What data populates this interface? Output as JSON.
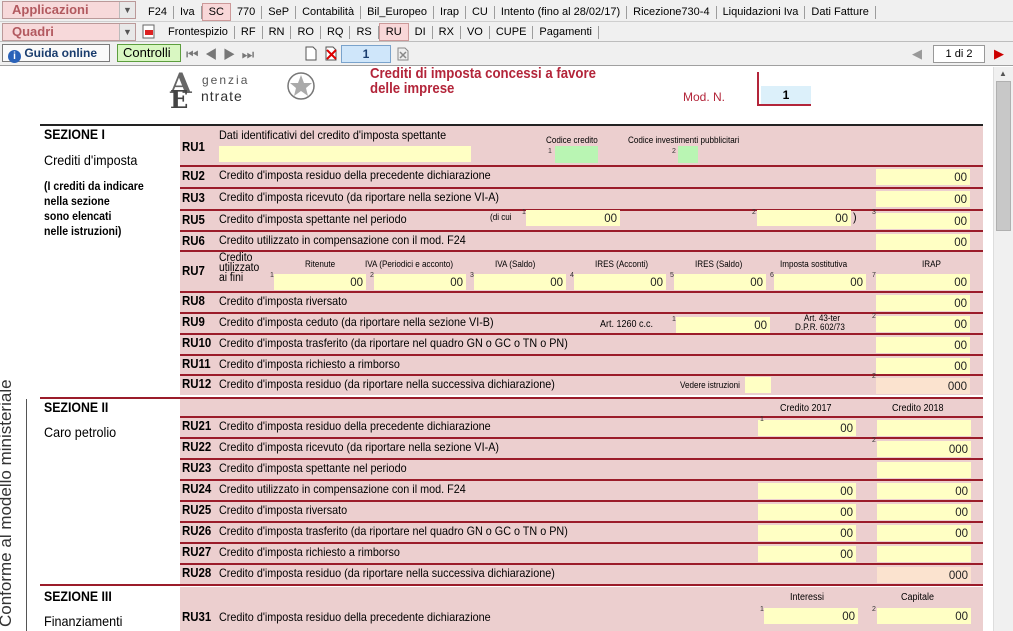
{
  "toolbar": {
    "applicazioni": "Applicazioni",
    "quadri": "Quadri",
    "tabs_top": [
      "F24",
      "Iva",
      "SC",
      "770",
      "SeP",
      "Contabilità",
      "Bil_Europeo",
      "Irap",
      "CU",
      "Intento (fino al 28/02/17)",
      "Ricezione730-4",
      "Liquidazioni Iva",
      "Dati Fatture"
    ],
    "selected_top": "SC",
    "tabs_quadri": [
      "Frontespizio",
      "RF",
      "RN",
      "RO",
      "RQ",
      "RS",
      "RU",
      "DI",
      "RX",
      "VO",
      "CUPE",
      "Pagamenti"
    ],
    "selected_quadro": "RU",
    "guida": "Guida online",
    "controlli": "Controlli",
    "page_num": "1",
    "page_of": "1 di 2"
  },
  "header": {
    "logo_line1": "genzia",
    "logo_line2": "ntrate",
    "title1": "Crediti di imposta concessi a favore",
    "title2": "delle imprese",
    "mod_label": "Mod. N.",
    "mod_value": "1"
  },
  "side_label": "Conforme al modello ministeriale",
  "sez1": {
    "title": "SEZIONE I",
    "subtitle": "Crediti d'imposta",
    "note": [
      "(I crediti da indicare",
      "nella sezione",
      "sono elencati",
      "nelle istruzioni)"
    ],
    "ru1": {
      "code": "RU1",
      "label": "Dati identificativi del credito d'imposta spettante",
      "codice_credito": "Codice credito",
      "codice_inv": "Codice investimenti pubblicitari"
    },
    "rows": [
      {
        "code": "RU2",
        "label": "Credito d'imposta residuo della precedente dichiarazione",
        "value": "00"
      },
      {
        "code": "RU3",
        "label": "Credito d'imposta ricevuto (da riportare nella sezione VI-A)",
        "value": "00"
      },
      {
        "code": "RU5",
        "label": "Credito d'imposta spettante nel periodo",
        "value": "00"
      },
      {
        "code": "RU6",
        "label": "Credito utilizzato in compensazione con il mod. F24",
        "value": "00"
      }
    ],
    "ru5_dicui": "(di cui",
    "ru5_close": ")",
    "ru5_v1": "00",
    "ru5_v2": "00",
    "ru7": {
      "code": "RU7",
      "label": [
        "Credito",
        "utilizzato",
        "ai fini"
      ],
      "cols": [
        "Ritenute",
        "IVA (Periodici e acconto)",
        "IVA (Saldo)",
        "IRES (Acconti)",
        "IRES (Saldo)",
        "Imposta sostitutiva",
        "IRAP"
      ],
      "values": [
        "00",
        "00",
        "00",
        "00",
        "00",
        "00",
        "00"
      ]
    },
    "rows2": [
      {
        "code": "RU8",
        "label": "Credito d'imposta riversato",
        "value": "00"
      },
      {
        "code": "RU9",
        "label": "Credito d'imposta ceduto (da riportare nella sezione VI-B)",
        "value": "00"
      },
      {
        "code": "RU10",
        "label": "Credito d'imposta trasferito (da riportare nel quadro GN o GC o TN o PN)",
        "value": "00"
      },
      {
        "code": "RU11",
        "label": "Credito d'imposta richiesto a rimborso",
        "value": "00"
      },
      {
        "code": "RU12",
        "label": "Credito d'imposta residuo (da riportare nella successiva dichiarazione)",
        "value": "000"
      }
    ],
    "ru9_art": "Art. 1260 c.c.",
    "ru9_art43_1": "Art. 43-ter",
    "ru9_art43_2": "D.P.R. 602/73",
    "ru9_v1": "00",
    "ru12_vedere": "Vedere istruzioni"
  },
  "sez2": {
    "title": "SEZIONE II",
    "subtitle": "Caro petrolio",
    "col1": "Credito 2017",
    "col2": "Credito 2018",
    "rows": [
      {
        "code": "RU21",
        "label": "Credito d'imposta residuo della precedente dichiarazione",
        "v1": "00",
        "v2": ""
      },
      {
        "code": "RU22",
        "label": "Credito d'imposta ricevuto (da riportare nella sezione VI-A)",
        "v1": "",
        "v2": "000"
      },
      {
        "code": "RU23",
        "label": "Credito d'imposta spettante nel periodo",
        "v1": "",
        "v2": ""
      },
      {
        "code": "RU24",
        "label": "Credito utilizzato in compensazione con il mod. F24",
        "v1": "00",
        "v2": "00"
      },
      {
        "code": "RU25",
        "label": "Credito d'imposta riversato",
        "v1": "00",
        "v2": "00"
      },
      {
        "code": "RU26",
        "label": "Credito d'imposta trasferito (da riportare nel quadro GN o GC o TN o PN)",
        "v1": "00",
        "v2": "00"
      },
      {
        "code": "RU27",
        "label": "Credito d'imposta richiesto a rimborso",
        "v1": "00",
        "v2": ""
      },
      {
        "code": "RU28",
        "label": "Credito d'imposta residuo (da riportare nella successiva dichiarazione)",
        "v1": "",
        "v2": "000"
      }
    ]
  },
  "sez3": {
    "title": "SEZIONE III",
    "subtitle": "Finanziamenti",
    "col1": "Interessi",
    "col2": "Capitale",
    "ru31": {
      "code": "RU31",
      "label": "Credito d'imposta residuo della precedente dichiarazione",
      "v1": "00",
      "v2": "00"
    }
  }
}
